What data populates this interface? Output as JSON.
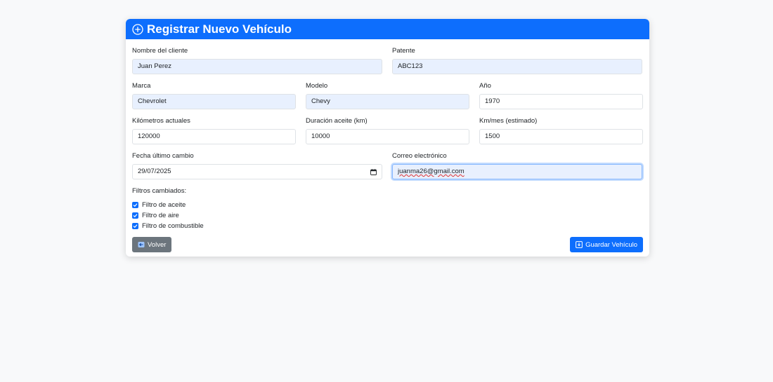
{
  "header": {
    "title": "Registrar Nuevo Vehículo",
    "icon": "plus-circle-icon"
  },
  "form": {
    "cliente": {
      "label": "Nombre del cliente",
      "value": "Juan Perez"
    },
    "patente": {
      "label": "Patente",
      "value": "ABC123"
    },
    "marca": {
      "label": "Marca",
      "value": "Chevrolet"
    },
    "modelo": {
      "label": "Modelo",
      "value": "Chevy"
    },
    "anio": {
      "label": "Año",
      "value": "1970"
    },
    "km_actuales": {
      "label": "Kilómetros actuales",
      "value": "120000"
    },
    "duracion_aceite": {
      "label": "Duración aceite (km)",
      "value": "10000"
    },
    "km_mes": {
      "label": "Km/mes (estimado)",
      "value": "1500"
    },
    "fecha_cambio": {
      "label": "Fecha último cambio",
      "value": "29/07/2025"
    },
    "correo": {
      "label": "Correo electrónico",
      "value": "juanma26@gmail.com"
    }
  },
  "filters": {
    "title": "Filtros cambiados:",
    "items": [
      {
        "label": "Filtro de aceite",
        "checked": true
      },
      {
        "label": "Filtro de aire",
        "checked": true
      },
      {
        "label": "Filtro de combustible",
        "checked": true
      }
    ]
  },
  "actions": {
    "back_label": "Volver",
    "save_label": "Guardar Vehículo"
  },
  "colors": {
    "primary": "#0d6efd",
    "secondary": "#6c757d",
    "autofill": "#e8f0fe"
  }
}
